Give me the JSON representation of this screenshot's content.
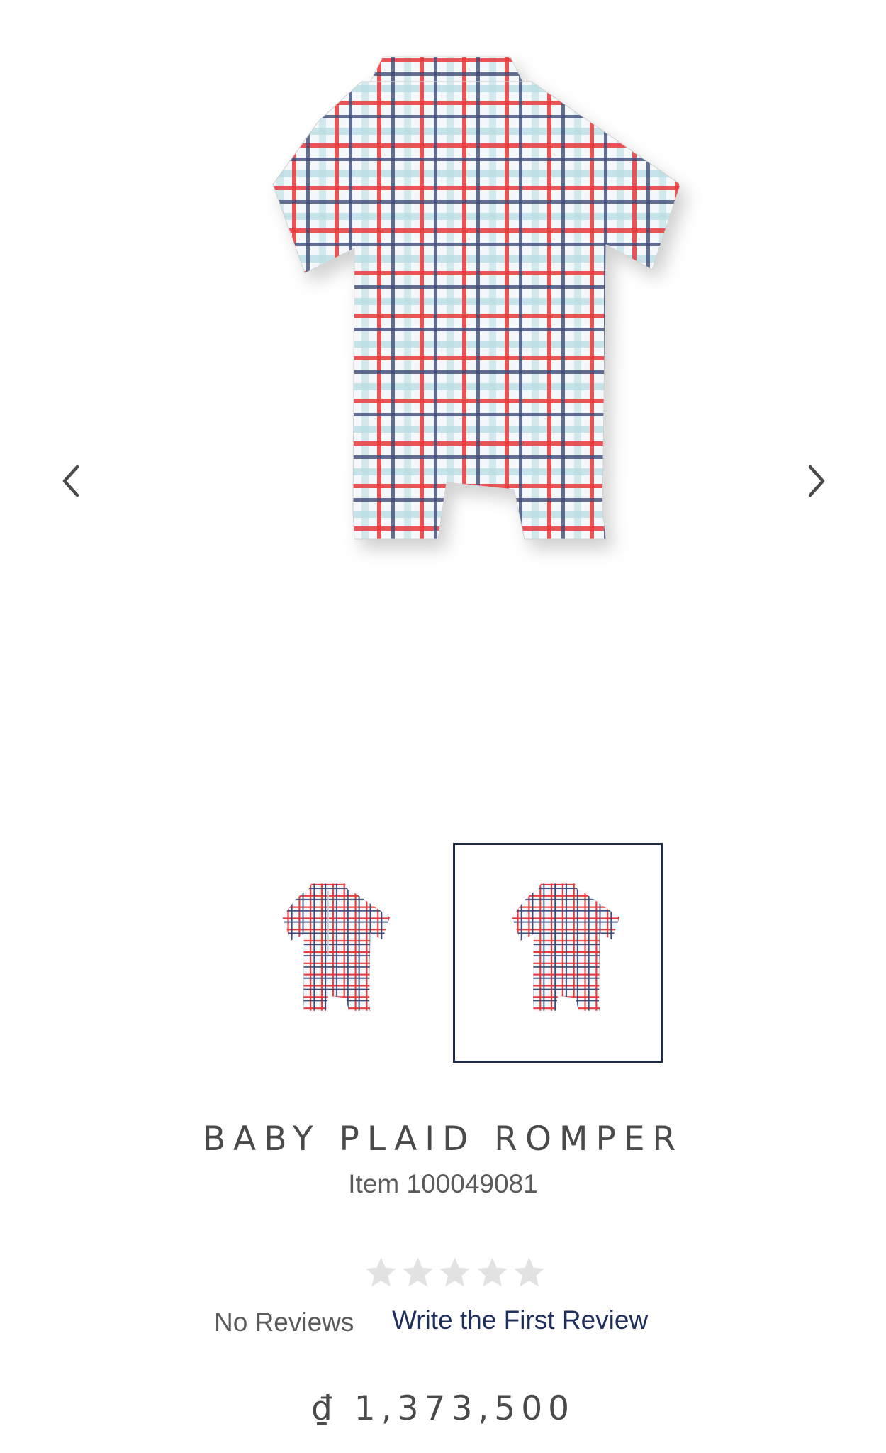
{
  "product": {
    "title": "BABY PLAID ROMPER",
    "item_number": "Item 100049081",
    "rating": 0,
    "rating_max": 5,
    "no_reviews_label": "No Reviews",
    "write_review_label": "Write the First Review",
    "price": "₫ 1,373,500"
  },
  "gallery": {
    "prev_icon": "chevron-left-icon",
    "next_icon": "chevron-right-icon",
    "main_image": "romper-back-view",
    "thumbnails": [
      {
        "name": "romper-front-view",
        "selected": false
      },
      {
        "name": "romper-back-view",
        "selected": true
      }
    ]
  },
  "colors": {
    "plaid_red": "#e8393a",
    "plaid_navy": "#3d4a78",
    "plaid_lightblue": "#a9d5dc",
    "selected_border": "#1f2a44",
    "link": "#1f2f5c",
    "star_empty": "#e2e2e2"
  }
}
